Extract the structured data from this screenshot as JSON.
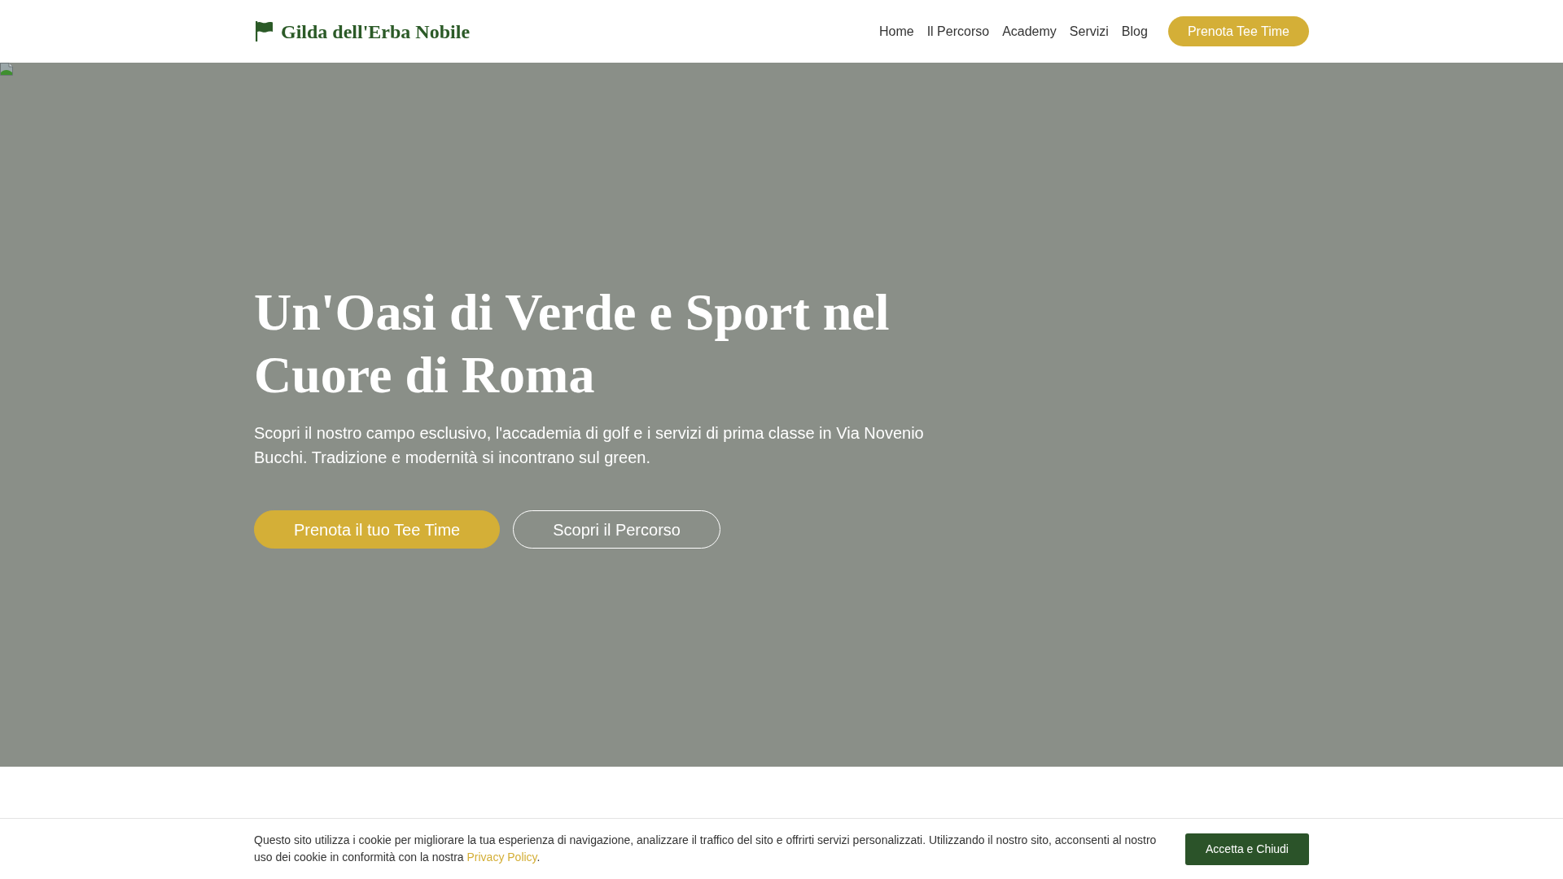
{
  "header": {
    "logo": "Gilda dell'Erba Nobile",
    "nav": [
      "Home",
      "Il Percorso",
      "Academy",
      "Servizi",
      "Blog"
    ],
    "cta": "Prenota Tee Time"
  },
  "hero": {
    "title": "Un'Oasi di Verde e Sport nel Cuore di Roma",
    "subtitle": "Scopri il nostro campo esclusivo, l'accademia di golf e i servizi di prima classe in Via Novenio Bucchi. Tradizione e modernità si incontrano sul green.",
    "buttons": [
      {
        "label": "Prenota il tuo Tee Time",
        "kind": "primary"
      },
      {
        "label": "Scopri il Percorso",
        "kind": "outline"
      }
    ]
  },
  "cookie_banner": {
    "text": "Questo sito utilizza i cookie per migliorare la tua esperienza di navigazione, analizzare il traffico del sito e offrirti servizi personalizzati. Utilizzando il nostro sito, acconsenti al nostro uso dei cookie in conformità con la nostra",
    "link": "Privacy Policy",
    "text_after": ".",
    "button": "Accetta e Chiudi"
  }
}
